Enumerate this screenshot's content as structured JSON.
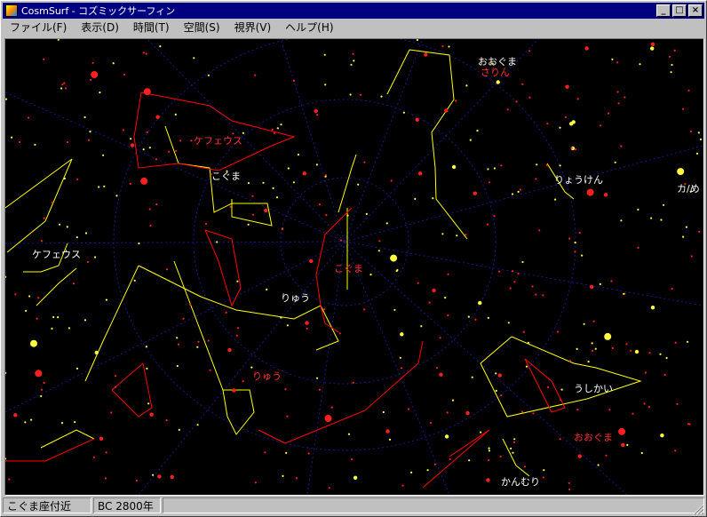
{
  "window": {
    "title": "CosmSurf - コズミックサーフィン",
    "minimize_glyph": "_",
    "maximize_glyph": "□",
    "close_glyph": "×"
  },
  "menu": [
    {
      "label": "ファイル(F)"
    },
    {
      "label": "表示(D)"
    },
    {
      "label": "時間(T)"
    },
    {
      "label": "空間(S)"
    },
    {
      "label": "視界(V)"
    },
    {
      "label": "ヘルプ(H)"
    }
  ],
  "sky": {
    "constellation_labels": [
      {
        "text": "ケフェウス",
        "color": "red"
      },
      {
        "text": "こぐま",
        "color": "white"
      },
      {
        "text": "ケフェウス",
        "color": "white"
      },
      {
        "text": "こぐま",
        "color": "red"
      },
      {
        "text": "りゅう",
        "color": "white"
      },
      {
        "text": "りゅう",
        "color": "red"
      },
      {
        "text": "おおぐま",
        "color": "white"
      },
      {
        "text": "さりん",
        "color": "red"
      },
      {
        "text": "りょうけん",
        "color": "white"
      },
      {
        "text": "うしかい",
        "color": "white"
      },
      {
        "text": "おおぐま",
        "color": "red"
      },
      {
        "text": "かんむり",
        "color": "white"
      },
      {
        "text": "カ/め",
        "color": "white"
      }
    ],
    "colors": {
      "background": "#000000",
      "line_yellow": "#ffff00",
      "line_red": "#ff0000",
      "grid": "#1a1a80",
      "star_red": "#ff2020",
      "star_yellow": "#ffff40"
    }
  },
  "status": {
    "location": "こぐま座付近",
    "epoch": "BC 2800年",
    "extra": ""
  }
}
